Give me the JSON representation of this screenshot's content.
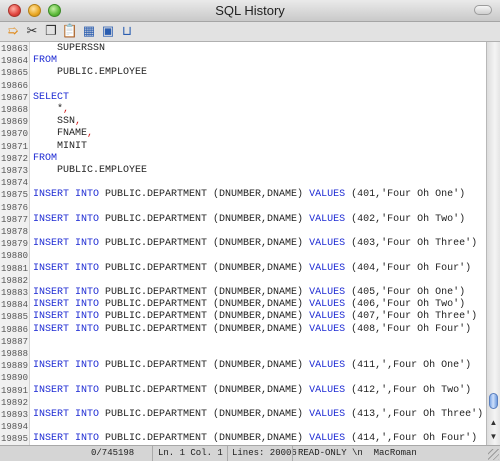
{
  "window": {
    "title": "SQL History"
  },
  "toolbar": {
    "buttons": [
      {
        "name": "run-icon",
        "glyph": "➯",
        "color": "#e08a1a"
      },
      {
        "name": "cut-icon",
        "glyph": "✂",
        "color": "#333333"
      },
      {
        "name": "copy-icon",
        "glyph": "❐",
        "color": "#333333"
      },
      {
        "name": "paste-icon",
        "glyph": "📋",
        "color": "#b48a3a"
      },
      {
        "name": "format-icon",
        "glyph": "▦",
        "color": "#2a5db0"
      },
      {
        "name": "clear-icon",
        "glyph": "▣",
        "color": "#2a5db0"
      },
      {
        "name": "recall-icon",
        "glyph": "⊔",
        "color": "#2a5db0"
      }
    ]
  },
  "editor": {
    "lines": [
      {
        "n": "19863",
        "tokens": [
          {
            "t": "    SUPERSSN",
            "c": "plain"
          }
        ]
      },
      {
        "n": "19864",
        "tokens": [
          {
            "t": "FROM",
            "c": "kw"
          }
        ]
      },
      {
        "n": "19865",
        "tokens": [
          {
            "t": "    PUBLIC.EMPLOYEE",
            "c": "plain"
          }
        ]
      },
      {
        "n": "19866",
        "tokens": []
      },
      {
        "n": "19867",
        "tokens": [
          {
            "t": "SELECT",
            "c": "kw"
          }
        ]
      },
      {
        "n": "19868",
        "tokens": [
          {
            "t": "    *",
            "c": "plain"
          },
          {
            "t": ",",
            "c": "punc"
          }
        ]
      },
      {
        "n": "19869",
        "tokens": [
          {
            "t": "    SSN",
            "c": "plain"
          },
          {
            "t": ",",
            "c": "punc"
          }
        ]
      },
      {
        "n": "19870",
        "tokens": [
          {
            "t": "    FNAME",
            "c": "plain"
          },
          {
            "t": ",",
            "c": "punc"
          }
        ]
      },
      {
        "n": "19871",
        "tokens": [
          {
            "t": "    MINIT",
            "c": "plain"
          }
        ]
      },
      {
        "n": "19872",
        "tokens": [
          {
            "t": "FROM",
            "c": "kw"
          }
        ]
      },
      {
        "n": "19873",
        "tokens": [
          {
            "t": "    PUBLIC.EMPLOYEE",
            "c": "plain"
          }
        ]
      },
      {
        "n": "19874",
        "tokens": []
      },
      {
        "n": "19875",
        "tokens": [
          {
            "t": "INSERT INTO",
            "c": "kw"
          },
          {
            "t": " PUBLIC.DEPARTMENT (DNUMBER,DNAME) ",
            "c": "plain"
          },
          {
            "t": "VALUES",
            "c": "kw"
          },
          {
            "t": " (401,'Four Oh One')",
            "c": "plain"
          }
        ]
      },
      {
        "n": "19876",
        "tokens": []
      },
      {
        "n": "19877",
        "tokens": [
          {
            "t": "INSERT INTO",
            "c": "kw"
          },
          {
            "t": " PUBLIC.DEPARTMENT (DNUMBER,DNAME) ",
            "c": "plain"
          },
          {
            "t": "VALUES",
            "c": "kw"
          },
          {
            "t": " (402,'Four Oh Two')",
            "c": "plain"
          }
        ]
      },
      {
        "n": "19878",
        "tokens": []
      },
      {
        "n": "19879",
        "tokens": [
          {
            "t": "INSERT INTO",
            "c": "kw"
          },
          {
            "t": " PUBLIC.DEPARTMENT (DNUMBER,DNAME) ",
            "c": "plain"
          },
          {
            "t": "VALUES",
            "c": "kw"
          },
          {
            "t": " (403,'Four Oh Three')",
            "c": "plain"
          }
        ]
      },
      {
        "n": "19880",
        "tokens": []
      },
      {
        "n": "19881",
        "tokens": [
          {
            "t": "INSERT INTO",
            "c": "kw"
          },
          {
            "t": " PUBLIC.DEPARTMENT (DNUMBER,DNAME) ",
            "c": "plain"
          },
          {
            "t": "VALUES",
            "c": "kw"
          },
          {
            "t": " (404,'Four Oh Four')",
            "c": "plain"
          }
        ]
      },
      {
        "n": "19882",
        "tokens": []
      },
      {
        "n": "19883",
        "tokens": [
          {
            "t": "INSERT INTO",
            "c": "kw"
          },
          {
            "t": " PUBLIC.DEPARTMENT (DNUMBER,DNAME) ",
            "c": "plain"
          },
          {
            "t": "VALUES",
            "c": "kw"
          },
          {
            "t": " (405,'Four Oh One')",
            "c": "plain"
          }
        ]
      },
      {
        "n": "19884",
        "tokens": [
          {
            "t": "INSERT INTO",
            "c": "kw"
          },
          {
            "t": " PUBLIC.DEPARTMENT (DNUMBER,DNAME) ",
            "c": "plain"
          },
          {
            "t": "VALUES",
            "c": "kw"
          },
          {
            "t": " (406,'Four Oh Two')",
            "c": "plain"
          }
        ]
      },
      {
        "n": "19885",
        "tokens": [
          {
            "t": "INSERT INTO",
            "c": "kw"
          },
          {
            "t": " PUBLIC.DEPARTMENT (DNUMBER,DNAME) ",
            "c": "plain"
          },
          {
            "t": "VALUES",
            "c": "kw"
          },
          {
            "t": " (407,'Four Oh Three')",
            "c": "plain"
          }
        ]
      },
      {
        "n": "19886",
        "tokens": [
          {
            "t": "INSERT INTO",
            "c": "kw"
          },
          {
            "t": " PUBLIC.DEPARTMENT (DNUMBER,DNAME) ",
            "c": "plain"
          },
          {
            "t": "VALUES",
            "c": "kw"
          },
          {
            "t": " (408,'Four Oh Four')",
            "c": "plain"
          }
        ]
      },
      {
        "n": "19887",
        "tokens": []
      },
      {
        "n": "19888",
        "tokens": []
      },
      {
        "n": "19889",
        "tokens": [
          {
            "t": "INSERT INTO",
            "c": "kw"
          },
          {
            "t": " PUBLIC.DEPARTMENT (DNUMBER,DNAME) ",
            "c": "plain"
          },
          {
            "t": "VALUES",
            "c": "kw"
          },
          {
            "t": " (411,',Four Oh One')",
            "c": "plain"
          }
        ]
      },
      {
        "n": "19890",
        "tokens": []
      },
      {
        "n": "19891",
        "tokens": [
          {
            "t": "INSERT INTO",
            "c": "kw"
          },
          {
            "t": " PUBLIC.DEPARTMENT (DNUMBER,DNAME) ",
            "c": "plain"
          },
          {
            "t": "VALUES",
            "c": "kw"
          },
          {
            "t": " (412,',Four Oh Two')",
            "c": "plain"
          }
        ]
      },
      {
        "n": "19892",
        "tokens": []
      },
      {
        "n": "19893",
        "tokens": [
          {
            "t": "INSERT INTO",
            "c": "kw"
          },
          {
            "t": " PUBLIC.DEPARTMENT (DNUMBER,DNAME) ",
            "c": "plain"
          },
          {
            "t": "VALUES",
            "c": "kw"
          },
          {
            "t": " (413,',Four Oh Three')",
            "c": "plain"
          }
        ]
      },
      {
        "n": "19894",
        "tokens": []
      },
      {
        "n": "19895",
        "tokens": [
          {
            "t": "INSERT INTO",
            "c": "kw"
          },
          {
            "t": " PUBLIC.DEPARTMENT (DNUMBER,DNAME) ",
            "c": "plain"
          },
          {
            "t": "VALUES",
            "c": "kw"
          },
          {
            "t": " (414,',Four Oh Four')",
            "c": "plain"
          }
        ]
      }
    ]
  },
  "statusbar": {
    "position": "0/745198",
    "cursor": "Ln. 1 Col. 1",
    "lines": "Lines: 20006",
    "mode": "READ-ONLY \\n  MacRoman"
  }
}
